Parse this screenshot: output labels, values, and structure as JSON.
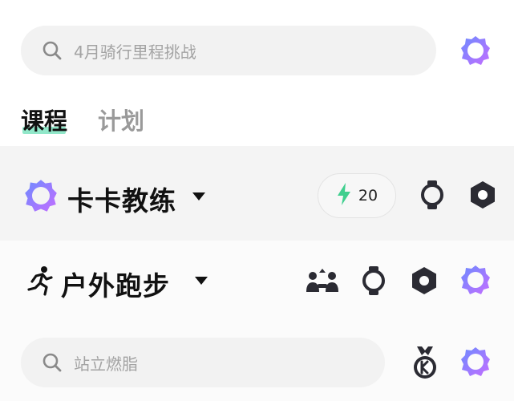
{
  "search": {
    "placeholder": "4月骑行里程挑战"
  },
  "tabs": [
    {
      "label": "课程",
      "active": true
    },
    {
      "label": "计划",
      "active": false
    }
  ],
  "coach_row": {
    "title": "卡卡教练",
    "energy_count": "20"
  },
  "run_row": {
    "title": "户外跑步"
  },
  "bottom_search": {
    "placeholder": "站立燃脂"
  },
  "colors": {
    "accent_green": "#3fcf8e",
    "underline": "#7ee3c0",
    "icon_dark": "#2b2b33",
    "badge_gradient": [
      "#6c8bff",
      "#c46dff"
    ]
  },
  "icons": [
    "search-icon",
    "app-badge-icon",
    "lightning-icon",
    "watch-icon",
    "hexagon-icon",
    "running-man-icon",
    "people-group-icon",
    "medal-icon",
    "caret-down-icon"
  ]
}
